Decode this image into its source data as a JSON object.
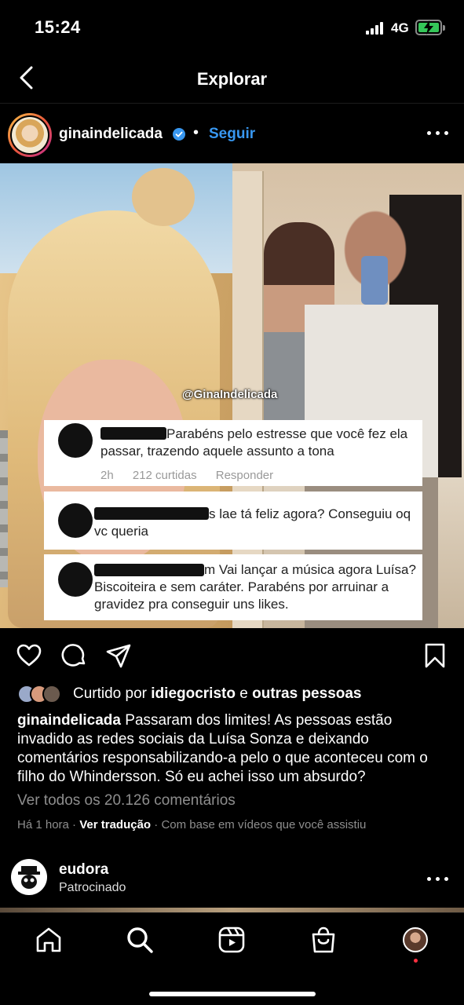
{
  "status_bar": {
    "time": "15:24",
    "network": "4G"
  },
  "header": {
    "title": "Explorar"
  },
  "post": {
    "username": "ginaindelicada",
    "follow_label": "Seguir",
    "watermark": "@GinaIndelicada",
    "comments_in_image": [
      {
        "text": "Parabéns pelo estresse que você fez ela passar, trazendo aquele assunto a tona",
        "time": "2h",
        "likes": "212 curtidas",
        "reply": "Responder"
      },
      {
        "text": "s lae tá feliz agora? Conseguiu oq vc queria"
      },
      {
        "text": "m Vai lançar a música agora Luísa? Biscoiteira e sem caráter. Parabéns por arruinar a gravidez pra conseguir uns likes."
      }
    ],
    "likes_prefix": "Curtido por",
    "likes_user": "idiegocristo",
    "likes_connector": "e",
    "likes_others": "outras pessoas",
    "caption_user": "ginaindelicada",
    "caption_text": "Passaram dos limites! As pessoas estão invadido as redes sociais da Luísa Sonza e deixando comentários responsabilizando-a pelo o que aconteceu com o filho do Whindersson. Só eu achei isso um absurdo?",
    "view_comments": "Ver todos os 20.126 comentários",
    "time_ago": "Há 1 hora",
    "translate_label": "Ver tradução",
    "suggestion_reason": "Com base em vídeos que você assistiu"
  },
  "sponsored": {
    "username": "eudora",
    "label": "Patrocinado"
  },
  "colors": {
    "link_blue": "#3897f0",
    "battery_green": "#35c759",
    "notification_red": "#ff3040"
  },
  "icons": {
    "header": [
      "back-arrow-icon"
    ],
    "actions": [
      "heart-icon",
      "comment-icon",
      "share-icon",
      "bookmark-icon"
    ],
    "tabs": [
      "home-icon",
      "search-icon",
      "reels-icon",
      "shop-icon",
      "profile-avatar"
    ]
  }
}
